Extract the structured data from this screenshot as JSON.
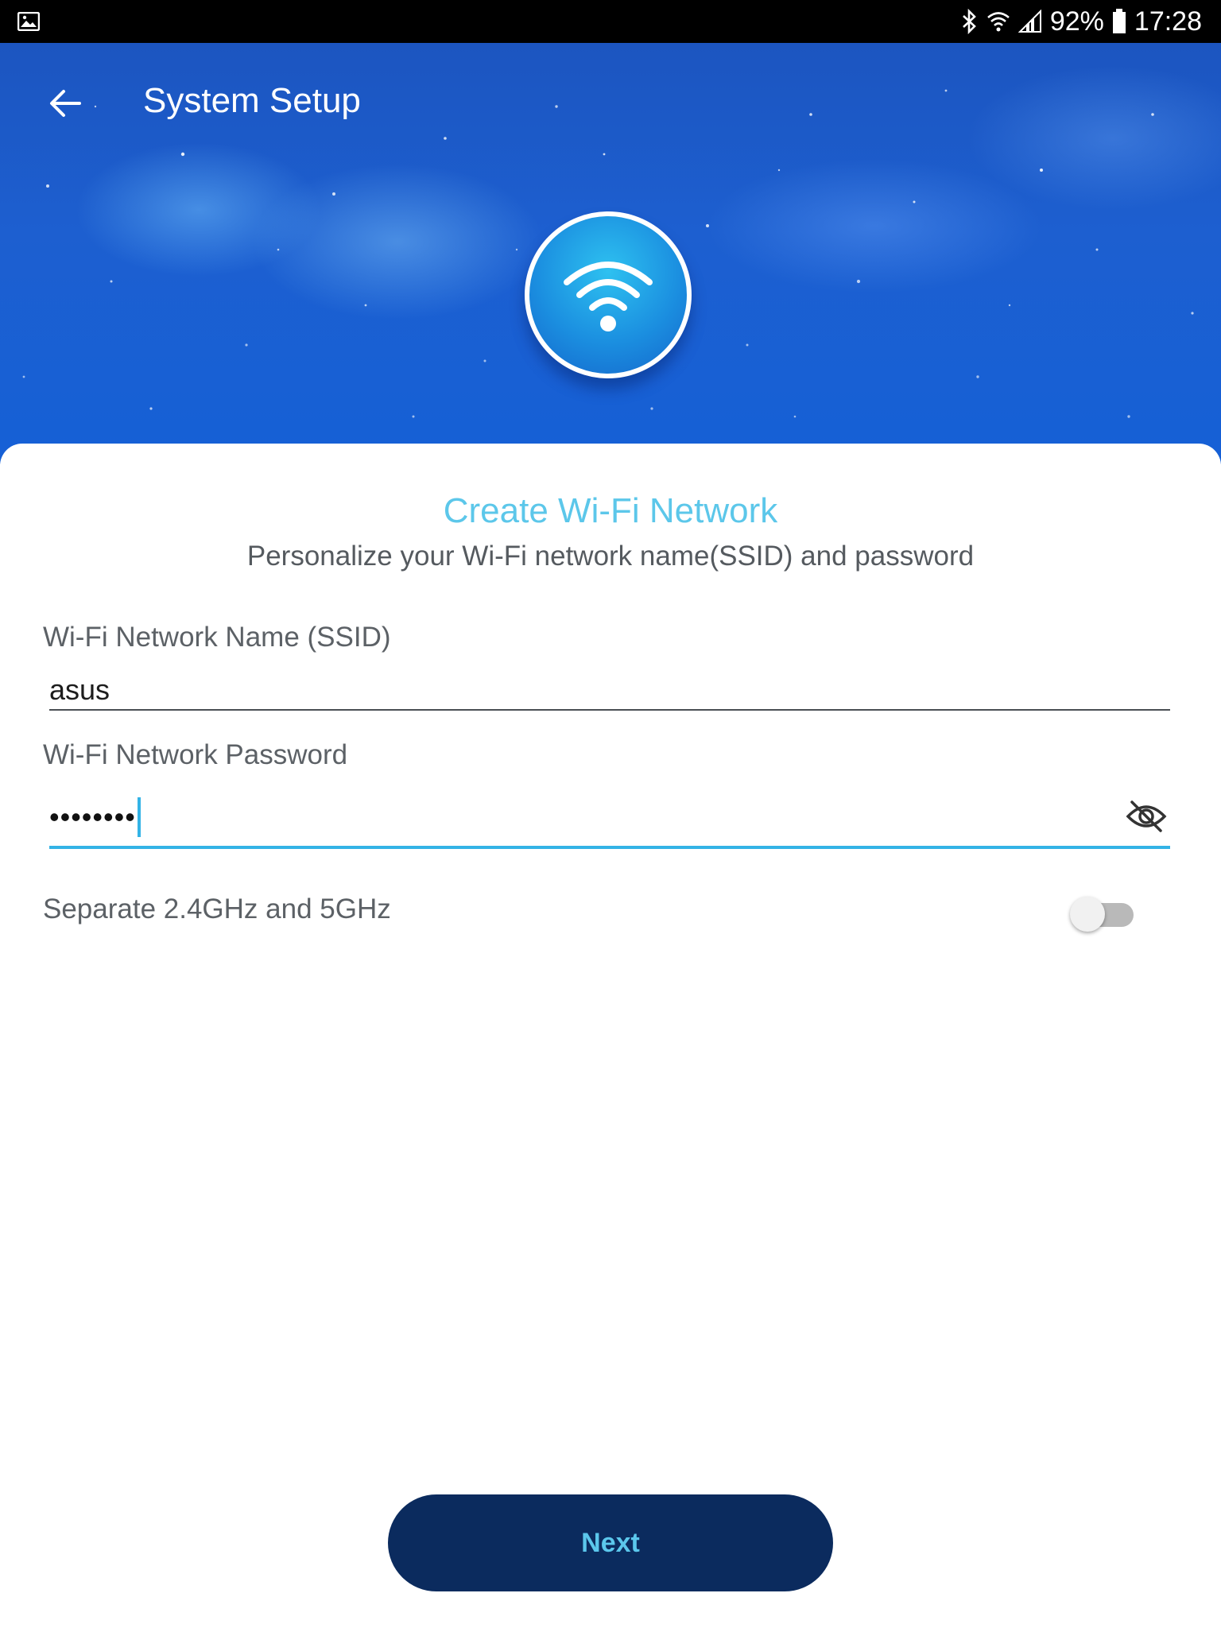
{
  "status_bar": {
    "battery_percent": "92%",
    "time": "17:28",
    "icons": [
      "gallery-icon",
      "bluetooth-icon",
      "wifi-icon",
      "signal-icon",
      "battery-icon"
    ]
  },
  "header": {
    "title": "System Setup",
    "back_icon": "arrow-left-icon",
    "badge_icon": "wifi-icon"
  },
  "card": {
    "title": "Create Wi-Fi Network",
    "subtitle": "Personalize your Wi-Fi network name(SSID) and password"
  },
  "form": {
    "ssid_label": "Wi-Fi Network Name (SSID)",
    "ssid_value": "asus",
    "password_label": "Wi-Fi Network Password",
    "password_masked": "••••••••",
    "password_visibility_icon": "eye-off-icon",
    "separate_bands_label": "Separate 2.4GHz and 5GHz",
    "separate_bands_enabled": false
  },
  "actions": {
    "next_label": "Next"
  },
  "colors": {
    "accent": "#33b3e6",
    "title_color": "#5cc7ea",
    "button_bg": "#0b2b5e",
    "button_text": "#5bc7ec",
    "header_blue": "#1d5fd0"
  }
}
